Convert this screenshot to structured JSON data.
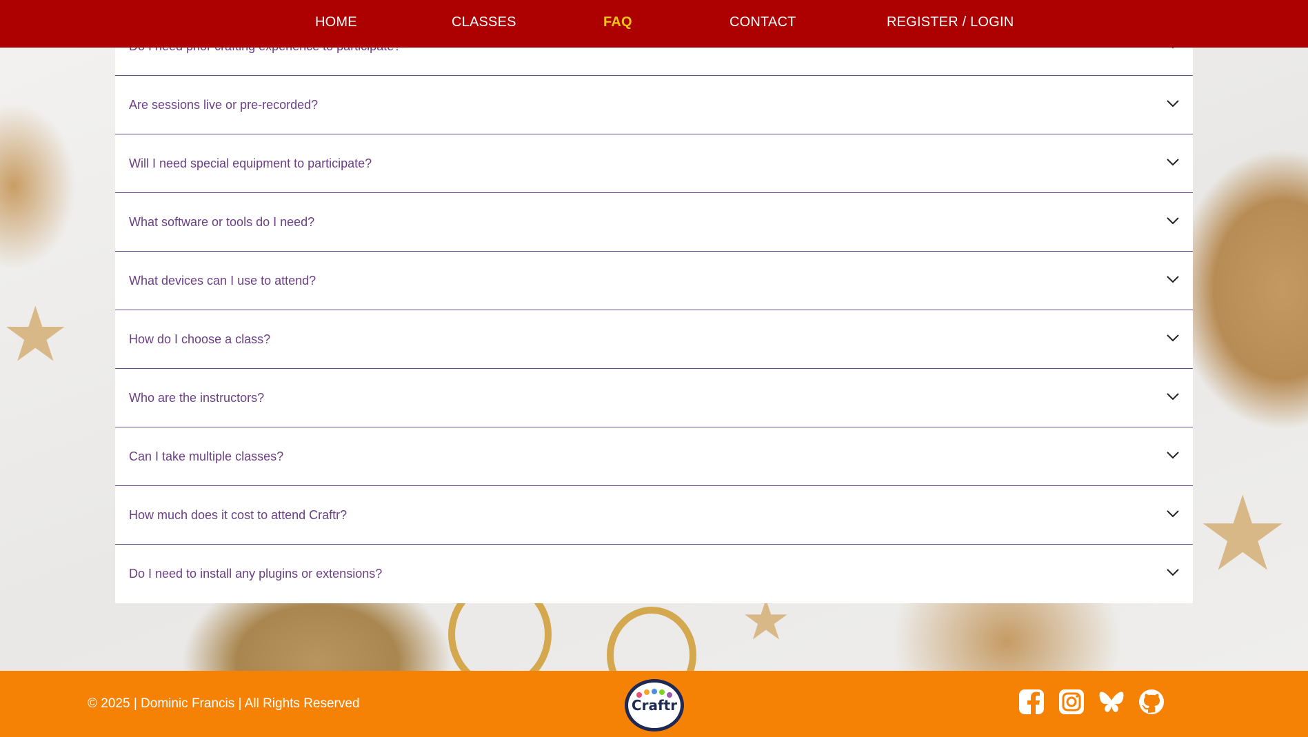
{
  "nav": {
    "home": "HOME",
    "classes": "CLASSES",
    "faq": "FAQ",
    "contact": "CONTACT",
    "register": "REGISTER / LOGIN"
  },
  "faq": {
    "items": [
      "Do I need prior crafting experience to participate?",
      "Are sessions live or pre-recorded?",
      "Will I need special equipment to participate?",
      "What software or tools do I need?",
      "What devices can I use to attend?",
      "How do I choose a class?",
      "Who are the instructors?",
      "Can I take multiple classes?",
      "How much does it cost to attend Craftr?",
      "Do I need to install any plugins or extensions?"
    ]
  },
  "footer": {
    "copyright": "© 2025 | Dominic Francis | All Rights Reserved",
    "logo_text": "Craftr",
    "social": [
      "facebook-icon",
      "instagram-icon",
      "bluesky-icon",
      "github-icon"
    ]
  },
  "colors": {
    "nav_bg": "#ad0000",
    "nav_active": "#f5c518",
    "faq_text": "#6b3f86",
    "footer_bg": "#f68205"
  }
}
